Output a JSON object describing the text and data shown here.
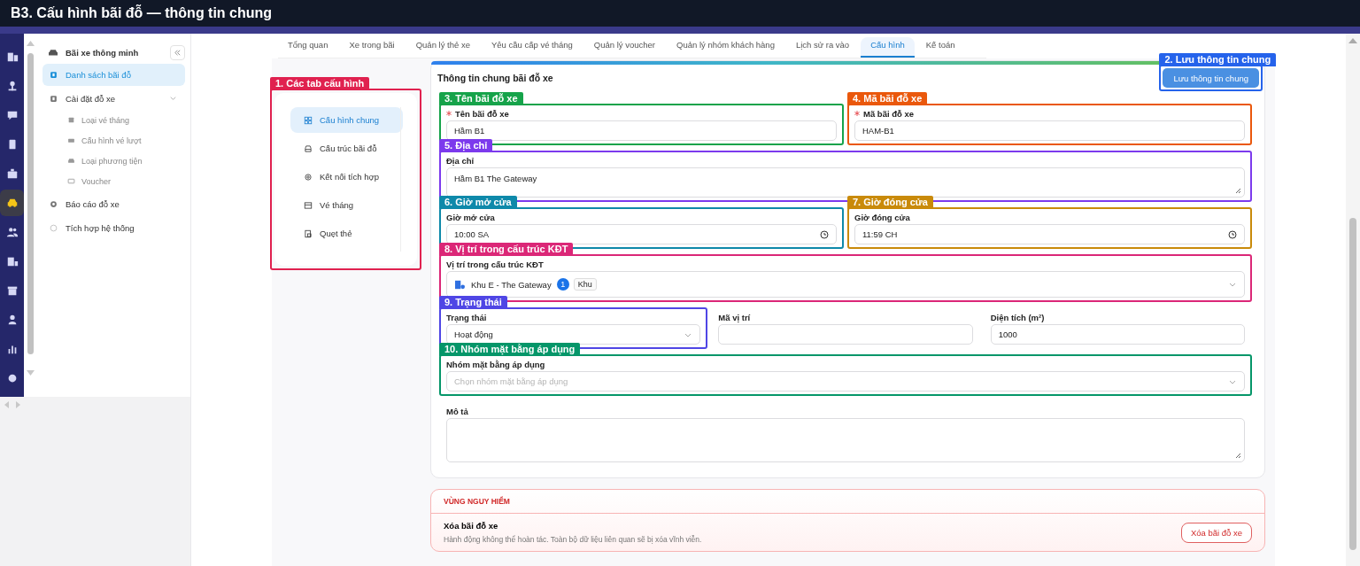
{
  "title": "B3. Cấu hình bãi đỗ — thông tin chung",
  "rail": {
    "items": [
      {
        "kind": "building",
        "selected": false
      },
      {
        "kind": "tree",
        "selected": false
      },
      {
        "kind": "chat",
        "selected": false
      },
      {
        "kind": "phone",
        "selected": false
      },
      {
        "kind": "briefcase",
        "selected": false
      },
      {
        "kind": "car",
        "selected": true
      },
      {
        "kind": "users",
        "selected": false
      },
      {
        "kind": "office",
        "selected": false
      },
      {
        "kind": "store",
        "selected": false
      },
      {
        "kind": "person",
        "selected": false
      },
      {
        "kind": "chart",
        "selected": false
      },
      {
        "kind": "gear",
        "selected": false
      }
    ]
  },
  "sidebar": {
    "header": "Bãi xe thông minh",
    "items": [
      {
        "label": "Danh sách bãi đỗ",
        "selected": true
      },
      {
        "label": "Cài đặt đỗ xe",
        "selected": false,
        "expanded": true,
        "children": [
          {
            "label": "Loại vé tháng",
            "selected": false
          },
          {
            "label": "Cấu hình vé lượt",
            "selected": false
          },
          {
            "label": "Loại phương tiện",
            "selected": false
          },
          {
            "label": "Voucher",
            "selected": false
          }
        ]
      },
      {
        "label": "Báo cáo đỗ xe",
        "selected": false
      },
      {
        "label": "Tích hợp hệ thống",
        "selected": false
      }
    ]
  },
  "tabs": [
    {
      "label": "Tổng quan",
      "selected": false
    },
    {
      "label": "Xe trong bãi",
      "selected": false
    },
    {
      "label": "Quản lý thẻ xe",
      "selected": false
    },
    {
      "label": "Yêu cầu cấp vé tháng",
      "selected": false
    },
    {
      "label": "Quản lý voucher",
      "selected": false
    },
    {
      "label": "Quản lý nhóm khách hàng",
      "selected": false
    },
    {
      "label": "Lịch sử ra vào",
      "selected": false
    },
    {
      "label": "Cấu hình",
      "selected": true
    },
    {
      "label": "Kế toán",
      "selected": false
    }
  ],
  "config_panel": {
    "annotation": {
      "label": "1. Các tab cấu hình",
      "color": "#e0214f"
    },
    "items": [
      {
        "label": "Cấu hình chung",
        "selected": true
      },
      {
        "label": "Cấu trúc bãi đỗ",
        "selected": false
      },
      {
        "label": "Kết nối tích hợp",
        "selected": false
      },
      {
        "label": "Vé tháng",
        "selected": false
      },
      {
        "label": "Quẹt thẻ",
        "selected": false
      }
    ]
  },
  "form": {
    "title": "Thông tin chung bãi đỗ xe",
    "save": {
      "label": "Lưu thông tin chung",
      "annotation": {
        "label": "2. Lưu thông tin chung",
        "color": "#2563eb"
      }
    },
    "rows": [
      {
        "fields": [
          {
            "kind": "text",
            "label": "Tên bãi đỗ xe",
            "required": true,
            "value": "Hầm B1",
            "annotation": {
              "label": "3. Tên bãi đỗ xe",
              "color": "#16a34a"
            }
          },
          {
            "kind": "text",
            "label": "Mã bãi đỗ xe",
            "required": true,
            "value": "HAM-B1",
            "annotation": {
              "label": "4. Mã bãi đỗ xe",
              "color": "#ea580c"
            }
          }
        ]
      },
      {
        "fields": [
          {
            "kind": "textarea",
            "label": "Địa chỉ",
            "required": false,
            "value": "Hầm B1 The Gateway",
            "annotation": {
              "label": "5. Địa chỉ",
              "color": "#7c3aed"
            }
          }
        ]
      },
      {
        "fields": [
          {
            "kind": "time",
            "label": "Giờ mở cửa",
            "required": false,
            "value": "10:00 SA",
            "annotation": {
              "label": "6. Giờ mở cửa",
              "color": "#0e89aa"
            }
          },
          {
            "kind": "time",
            "label": "Giờ đóng cửa",
            "required": false,
            "value": "11:59 CH",
            "annotation": {
              "label": "7. Giờ đóng cửa",
              "color": "#c98a0a"
            }
          }
        ]
      },
      {
        "fields": [
          {
            "kind": "tree-select",
            "label": "Vị trí trong cấu trúc KĐT",
            "required": false,
            "value": "Khu E - The Gateway",
            "count": "1",
            "chip": "Khu",
            "annotation": {
              "label": "8. Vị trí trong cấu trúc KĐT",
              "color": "#db2777"
            }
          }
        ]
      },
      {
        "fields": [
          {
            "kind": "select",
            "label": "Trạng thái",
            "required": false,
            "value": "Hoạt động",
            "annotation": {
              "label": "9. Trạng thái",
              "color": "#4f46e5"
            }
          },
          {
            "kind": "text",
            "label": "Mã vị trí",
            "required": false
          },
          {
            "kind": "text",
            "label": "Diện tích (m²)",
            "required": false,
            "value": "1000"
          }
        ]
      },
      {
        "fields": [
          {
            "kind": "select",
            "label": "Nhóm mặt bằng áp dụng",
            "required": false,
            "placeholder": "Chọn nhóm mặt bằng áp dụng",
            "annotation": {
              "label": "10. Nhóm mặt bằng áp dụng",
              "color": "#059669"
            }
          }
        ]
      },
      {
        "fields": [
          {
            "kind": "textarea",
            "label": "Mô tả",
            "required": false
          }
        ]
      }
    ]
  },
  "danger_zone": {
    "title": "VÙNG NGUY HIỂM",
    "action_title": "Xóa bãi đỗ xe",
    "description": "Hành động không thể hoàn tác. Toàn bộ dữ liệu liên quan sẽ bị xóa vĩnh viễn.",
    "button": "Xóa bãi đỗ xe"
  }
}
